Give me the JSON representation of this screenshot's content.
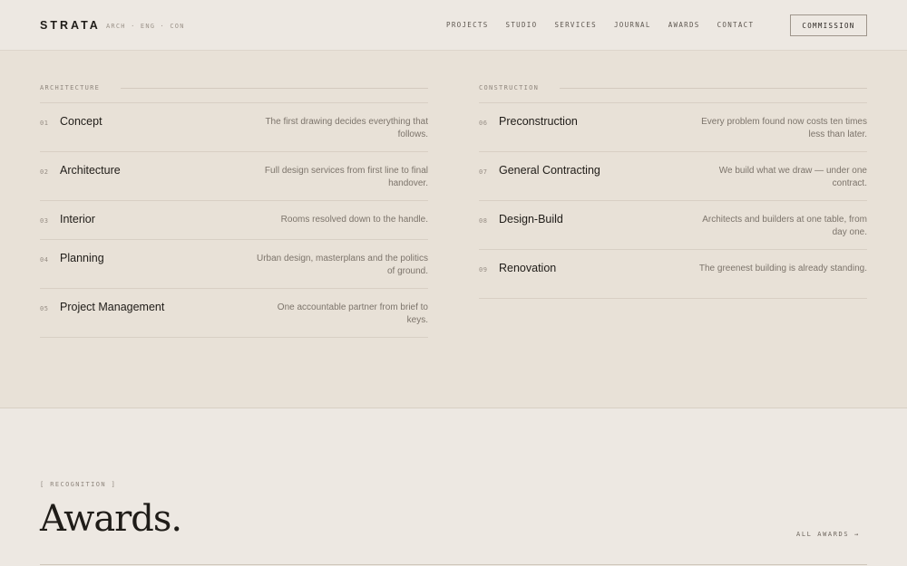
{
  "header": {
    "logo": "STRATA",
    "tagline": "ARCH · ENG · CON",
    "nav": [
      "PROJECTS",
      "STUDIO",
      "SERVICES",
      "JOURNAL",
      "AWARDS",
      "CONTACT"
    ],
    "cta": "COMMISSION"
  },
  "architecture": {
    "title": "ARCHITECTURE",
    "items": [
      {
        "num": "01",
        "name": "Concept",
        "desc": "The first drawing decides everything that follows."
      },
      {
        "num": "02",
        "name": "Architecture",
        "desc": "Full design services from first line to final handover."
      },
      {
        "num": "03",
        "name": "Interior",
        "desc": "Rooms resolved down to the handle."
      },
      {
        "num": "04",
        "name": "Planning",
        "desc": "Urban design, masterplans and the politics of ground."
      },
      {
        "num": "05",
        "name": "Project Management",
        "desc": "One accountable partner from brief to keys."
      }
    ]
  },
  "construction": {
    "title": "CONSTRUCTION",
    "items": [
      {
        "num": "06",
        "name": "Preconstruction",
        "desc": "Every problem found now costs ten times less than later."
      },
      {
        "num": "07",
        "name": "General Contracting",
        "desc": "We build what we draw — under one contract."
      },
      {
        "num": "08",
        "name": "Design-Build",
        "desc": "Architects and builders at one table, from day one."
      },
      {
        "num": "09",
        "name": "Renovation",
        "desc": "The greenest building is already standing."
      }
    ]
  },
  "recognition": {
    "label": "[ RECOGNITION ]",
    "title": "Awards.",
    "link": "ALL AWARDS →"
  }
}
